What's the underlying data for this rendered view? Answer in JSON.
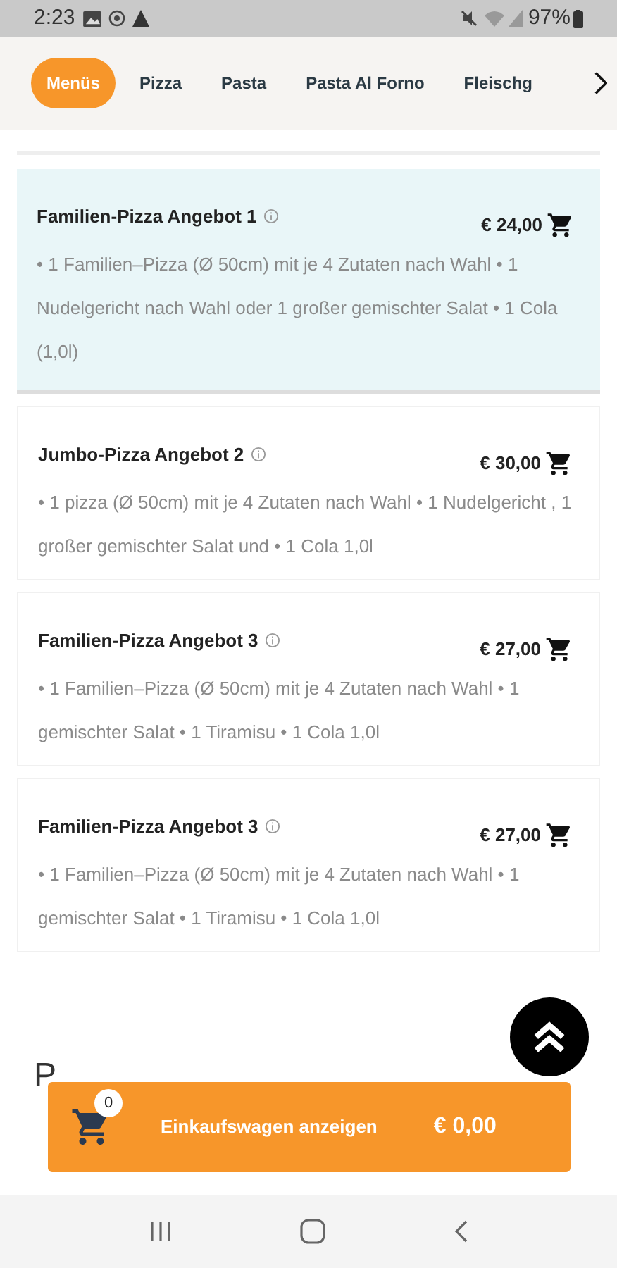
{
  "status_bar": {
    "time": "2:23",
    "battery": "97%"
  },
  "tabs": [
    {
      "label": "Menüs",
      "selected": true
    },
    {
      "label": "Pizza",
      "selected": false
    },
    {
      "label": "Pasta",
      "selected": false
    },
    {
      "label": "Pasta Al Forno",
      "selected": false
    },
    {
      "label": "Fleischg",
      "selected": false
    }
  ],
  "items": [
    {
      "name": "Familien-Pizza Angebot 1",
      "price": "€ 24,00",
      "description": "• 1 Familien–Pizza (Ø 50cm) mit je 4 Zutaten nach Wahl • 1 Nudelgericht nach Wahl oder 1 großer gemischter Salat • 1 Cola (1,0l)",
      "selected": true
    },
    {
      "name": "Jumbo-Pizza Angebot 2",
      "price": "€ 30,00",
      "description": "• 1 pizza (Ø 50cm) mit je 4 Zutaten nach Wahl • 1 Nudelgericht , 1 großer gemischter Salat und • 1 Cola 1,0l",
      "selected": false
    },
    {
      "name": "Familien-Pizza Angebot 3",
      "price": "€ 27,00",
      "description": "• 1 Familien–Pizza (Ø 50cm) mit je 4 Zutaten nach Wahl • 1 gemischter Salat • 1 Tiramisu • 1 Cola 1,0l",
      "selected": false
    },
    {
      "name": "Familien-Pizza Angebot 3",
      "price": "€ 27,00",
      "description": "• 1 Familien–Pizza (Ø 50cm) mit je 4 Zutaten nach Wahl • 1 gemischter Salat • 1 Tiramisu • 1 Cola 1,0l",
      "selected": false
    }
  ],
  "next_section": {
    "heading": "P"
  },
  "cart": {
    "count": "0",
    "label": "Einkaufswagen anzeigen",
    "total": "€ 0,00"
  }
}
